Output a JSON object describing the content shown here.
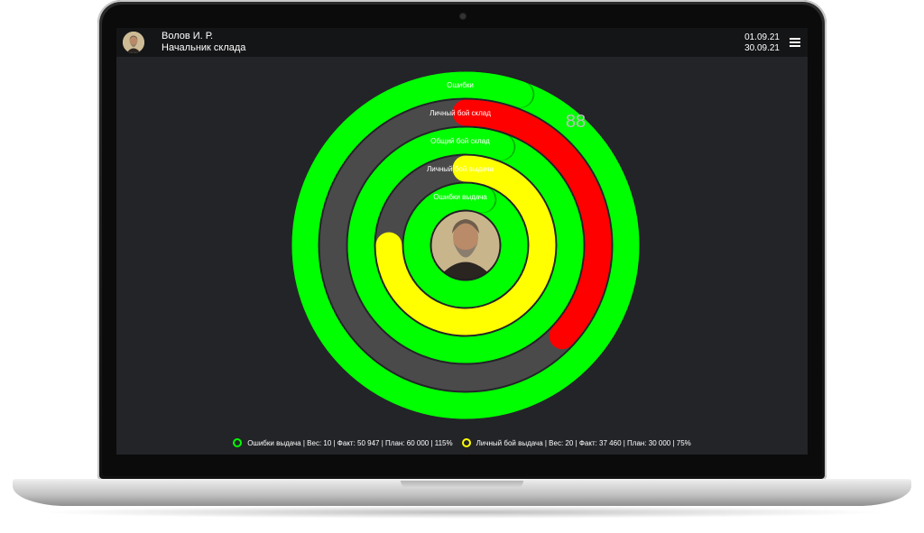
{
  "header": {
    "user_name": "Волов И. Р.",
    "user_role": "Начальник склада",
    "date_from": "01.09.21",
    "date_to": "30.09.21",
    "menu_icon": "hamburger-menu-icon"
  },
  "colors": {
    "green": "#00ff00",
    "red": "#ff0000",
    "yellow": "#ffff00",
    "track": "#4a4a4a",
    "background": "#232428"
  },
  "chart_data": {
    "type": "radial-rings",
    "score": "88",
    "rings": [
      {
        "label": "Ошибки",
        "color": "#00ff00",
        "fraction": 1.0
      },
      {
        "label": "Личный бой склад",
        "color": "#ff0000",
        "fraction": 0.37
      },
      {
        "label": "Общий бой склад",
        "color": "#00ff00",
        "fraction": 1.0
      },
      {
        "label": "Личный бой выдача",
        "color": "#ffff00",
        "fraction": 0.75
      },
      {
        "label": "Ошибки выдача",
        "color": "#00ff00",
        "fraction": 1.0
      }
    ]
  },
  "legend": [
    {
      "text": "Ошибки выдача | Вес: 10 | Факт: 50 947 | План: 60 000 | 115%",
      "color": "#00ff00"
    },
    {
      "text": "Личный бой выдача | Вес: 20 | Факт: 37 460 | План: 30 000 | 75%",
      "color": "#ffff00"
    }
  ]
}
